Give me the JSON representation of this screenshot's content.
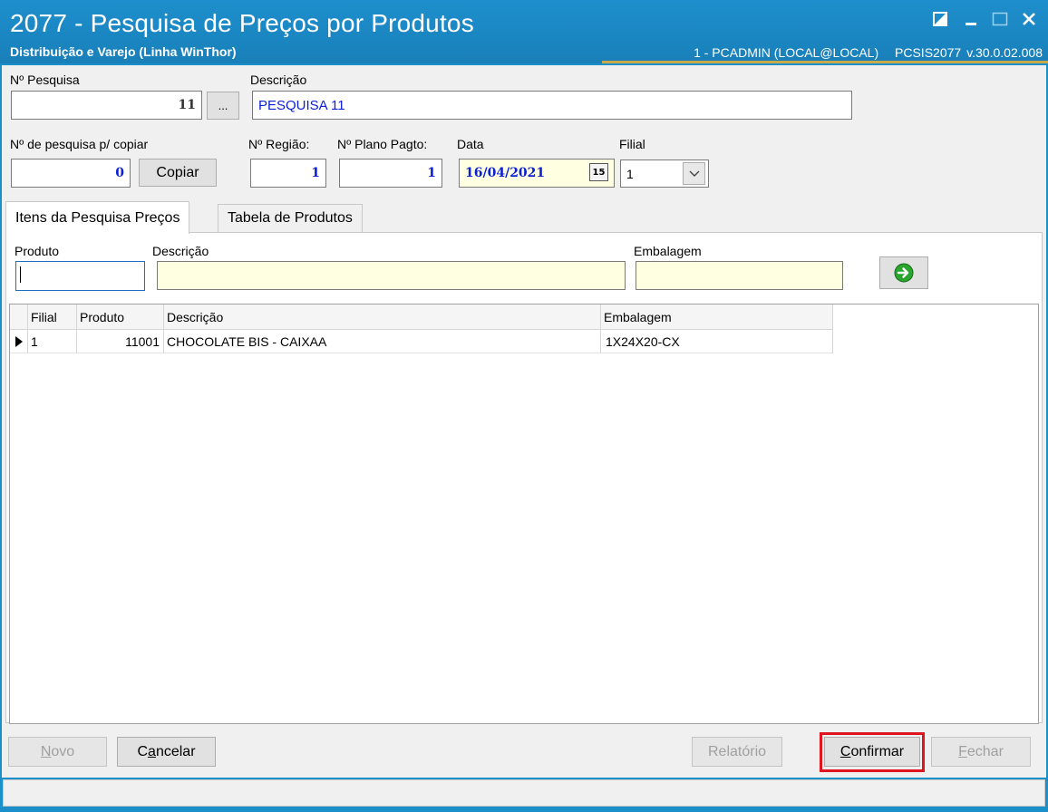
{
  "window": {
    "title": "2077 - Pesquisa de Preços por Produtos",
    "subtitle": "Distribuição e Varejo (Linha WinThor)",
    "user": "1 - PCADMIN (LOCAL@LOCAL)",
    "program": "PCSIS2077",
    "version": "v.30.0.02.008"
  },
  "form": {
    "pesquisa": {
      "label": "Nº Pesquisa",
      "value": "11",
      "lookup_label": "..."
    },
    "descricao": {
      "label": "Descrição",
      "value": "PESQUISA 11"
    },
    "copiar": {
      "label": "Nº de pesquisa p/ copiar",
      "value": "0",
      "button_label": "Copiar"
    },
    "regiao": {
      "label": "Nº Região:",
      "value": "1"
    },
    "plano_pagto": {
      "label": "Nº Plano Pagto:",
      "value": "1"
    },
    "data": {
      "label": "Data",
      "value": "16/04/2021",
      "calendar_glyph": "15"
    },
    "filial": {
      "label": "Filial",
      "value": "1"
    }
  },
  "tabs": [
    {
      "label": "Itens da Pesquisa Preços",
      "active": true
    },
    {
      "label": "Tabela de Produtos",
      "active": false
    }
  ],
  "filter": {
    "produto_label": "Produto",
    "descricao_label": "Descrição",
    "embalagem_label": "Embalagem",
    "produto_value": "",
    "descricao_value": "",
    "embalagem_value": ""
  },
  "grid": {
    "columns": [
      "Filial",
      "Produto",
      "Descrição",
      "Embalagem"
    ],
    "rows": [
      {
        "filial": "1",
        "produto": "11001",
        "descricao": "CHOCOLATE BIS  - CAIXAA",
        "embalagem": "1X24X20-CX"
      }
    ]
  },
  "buttons": {
    "novo": {
      "prefix": "",
      "accel": "N",
      "rest": "ovo"
    },
    "cancelar": {
      "prefix": "C",
      "accel": "a",
      "rest": "ncelar"
    },
    "relatorio": "Relatório",
    "confirmar": {
      "prefix": "",
      "accel": "C",
      "rest": "onfirmar"
    },
    "fechar": {
      "prefix": "",
      "accel": "F",
      "rest": "echar"
    }
  },
  "colors": {
    "titlebar": "#1e8fcc",
    "accent_gold": "#c9a94a",
    "value_blue": "#0b1fd6",
    "highlight_red": "#e0141e",
    "go_green": "#2aa52e"
  }
}
